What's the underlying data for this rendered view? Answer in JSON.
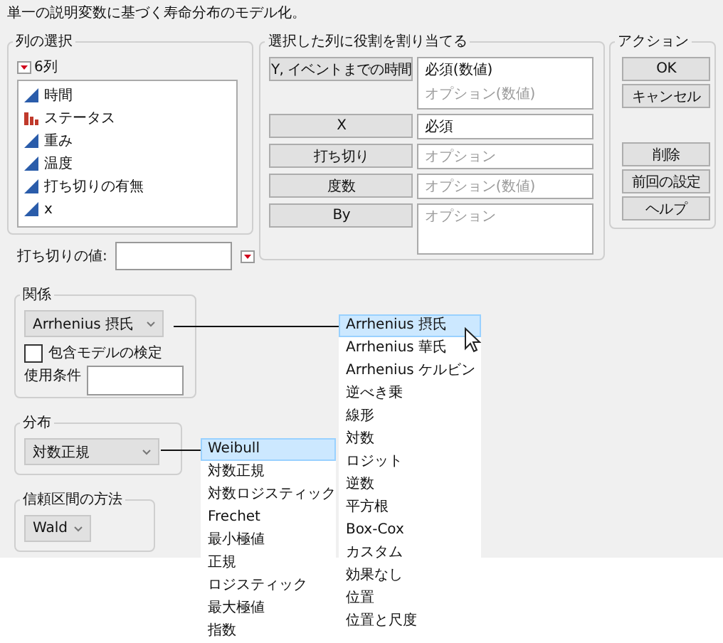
{
  "title": "単一の説明変数に基づく寿命分布のモデル化。",
  "columns": {
    "title": "列の選択",
    "count": "6列",
    "items": [
      {
        "name": "時間",
        "kind": "continuous"
      },
      {
        "name": "ステータス",
        "kind": "nominal"
      },
      {
        "name": "重み",
        "kind": "continuous"
      },
      {
        "name": "温度",
        "kind": "continuous"
      },
      {
        "name": "打ち切りの有無",
        "kind": "continuous"
      },
      {
        "name": "x",
        "kind": "continuous"
      }
    ]
  },
  "censor_value": {
    "label": "打ち切りの値:"
  },
  "roles": {
    "title": "選択した列に役割を割り当てる",
    "rows": [
      {
        "button": "Y, イベントまでの時間",
        "kind": "multi",
        "lines": [
          {
            "text": "必須(数値)",
            "required": true
          },
          {
            "text": "オプション(数値)",
            "required": false
          }
        ]
      },
      {
        "button": "X",
        "kind": "single",
        "lines": [
          {
            "text": "必須",
            "required": true
          }
        ]
      },
      {
        "button": "打ち切り",
        "kind": "single",
        "lines": [
          {
            "text": "オプション",
            "required": false
          }
        ]
      },
      {
        "button": "度数",
        "kind": "single",
        "lines": [
          {
            "text": "オプション(数値)",
            "required": false
          }
        ]
      },
      {
        "button": "By",
        "kind": "tall",
        "lines": [
          {
            "text": "オプション",
            "required": false
          }
        ]
      }
    ]
  },
  "actions": {
    "title": "アクション",
    "buttons": [
      "OK",
      "キャンセル"
    ],
    "secondary_buttons": [
      "削除",
      "前回の設定",
      "ヘルプ"
    ]
  },
  "relation": {
    "title": "関係",
    "value": "Arrhenius 摂氏",
    "checkbox": {
      "label": "包含モデルの検定",
      "checked": false
    },
    "condition": {
      "label": "使用条件"
    }
  },
  "distribution": {
    "title": "分布",
    "value": "対数正規"
  },
  "ci_method": {
    "title": "信頼区間の方法",
    "value": "Wald"
  },
  "relation_menu": {
    "items": [
      {
        "label": "Arrhenius 摂氏",
        "selected": true
      },
      {
        "label": "Arrhenius 華氏",
        "selected": false
      },
      {
        "label": "Arrhenius ケルビン",
        "selected": false
      },
      {
        "label": "逆べき乗",
        "selected": false
      },
      {
        "label": "線形",
        "selected": false
      },
      {
        "label": "対数",
        "selected": false
      },
      {
        "label": "ロジット",
        "selected": false
      },
      {
        "label": "逆数",
        "selected": false
      },
      {
        "label": "平方根",
        "selected": false
      },
      {
        "label": "Box-Cox",
        "selected": false
      },
      {
        "label": "カスタム",
        "selected": false
      },
      {
        "label": "効果なし",
        "selected": false
      },
      {
        "label": "位置",
        "selected": false
      },
      {
        "label": "位置と尺度",
        "selected": false
      }
    ]
  },
  "distribution_menu": {
    "items": [
      {
        "label": "Weibull",
        "selected": true
      },
      {
        "label": "対数正規",
        "selected": false
      },
      {
        "label": "対数ロジスティック",
        "selected": false
      },
      {
        "label": "Frechet",
        "selected": false
      },
      {
        "label": "最小極値",
        "selected": false
      },
      {
        "label": "正規",
        "selected": false
      },
      {
        "label": "ロジスティック",
        "selected": false
      },
      {
        "label": "最大極値",
        "selected": false
      },
      {
        "label": "指数",
        "selected": false
      }
    ]
  }
}
